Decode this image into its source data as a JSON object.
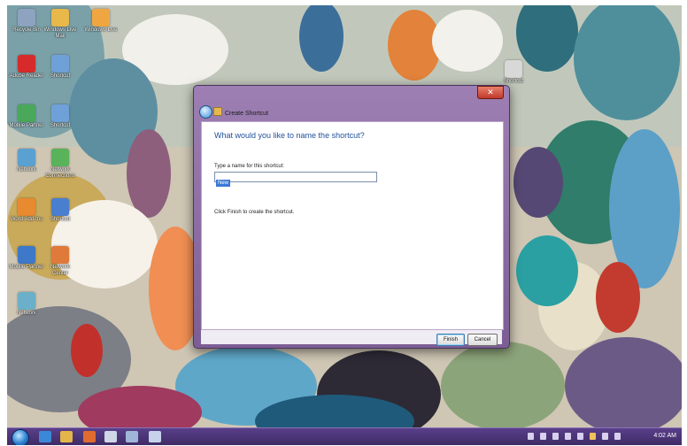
{
  "desktop": {
    "icons": [
      {
        "label": "Recycle Bin",
        "color": "#8ea3c0"
      },
      {
        "label": "Windows Live Mail",
        "color": "#e8b84a"
      },
      {
        "label": "Windows Live",
        "color": "#f0a640"
      },
      {
        "label": "Adobe Reader",
        "color": "#d72b2b"
      },
      {
        "label": "Shortcut",
        "color": "#6fa0d8"
      },
      {
        "label": "Mobile Partner",
        "color": "#4aa85a"
      },
      {
        "label": "Shortcut",
        "color": "#6fa0d8"
      },
      {
        "label": "Network",
        "color": "#5aa0d0"
      },
      {
        "label": "Network Connections",
        "color": "#58b35a"
      },
      {
        "label": "Word Add-Ins",
        "color": "#e88a30"
      },
      {
        "label": "Shortcut",
        "color": "#4a7fd0"
      },
      {
        "label": "Mobile Partner",
        "color": "#3d79c8"
      },
      {
        "label": "Network Center",
        "color": "#e07a3a"
      },
      {
        "label": "Network",
        "color": "#6bb0c8"
      }
    ],
    "right_icon": {
      "label": "Shortcut",
      "color": "#d8d8d8"
    }
  },
  "dialog": {
    "nav_title": "Create Shortcut",
    "heading": "What would you like to name the shortcut?",
    "name_label": "Type a name for this shortcut:",
    "name_value": "New",
    "finish_hint": "Click Finish to create the shortcut.",
    "finish_label": "Finish",
    "cancel_label": "Cancel",
    "close_glyph": "✕"
  },
  "taskbar": {
    "clock": "4:02 AM",
    "pinned": [
      {
        "name": "ie",
        "color": "#3b88d8"
      },
      {
        "name": "explorer",
        "color": "#e3b54a"
      },
      {
        "name": "media",
        "color": "#e06b2f"
      },
      {
        "name": "app1",
        "color": "#cfd6e6"
      },
      {
        "name": "app2",
        "color": "#9fb6d8"
      },
      {
        "name": "app3",
        "color": "#c7d3ea"
      }
    ]
  }
}
